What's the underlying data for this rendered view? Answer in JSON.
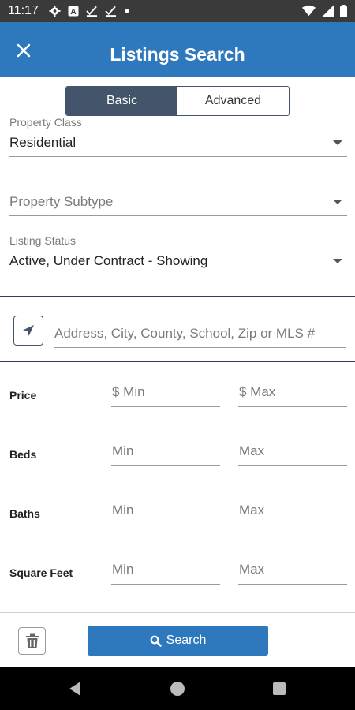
{
  "status_bar": {
    "time": "11:17",
    "icons_left": [
      "settings-icon",
      "a-icon",
      "check-icon",
      "check-icon",
      "dot-icon"
    ],
    "icons_right": [
      "wifi-icon",
      "signal-icon",
      "battery-icon"
    ]
  },
  "app_bar": {
    "title": "Listings Search",
    "close_icon": "close-icon",
    "color": "#2e78bd"
  },
  "mode_toggle": {
    "options": [
      "Basic",
      "Advanced"
    ],
    "selected": "Basic"
  },
  "property_class": {
    "label": "Property Class",
    "value": "Residential"
  },
  "property_subtype": {
    "placeholder": "Property Subtype"
  },
  "listing_status": {
    "label": "Listing Status",
    "value": "Active, Under Contract - Showing"
  },
  "location_search": {
    "icon": "location-arrow-icon",
    "placeholder": "Address, City, County, School, Zip or MLS #"
  },
  "ranges": [
    {
      "label": "Price",
      "min_placeholder": "$  Min",
      "max_placeholder": "$  Max"
    },
    {
      "label": "Beds",
      "min_placeholder": "Min",
      "max_placeholder": "Max"
    },
    {
      "label": "Baths",
      "min_placeholder": "Min",
      "max_placeholder": "Max"
    },
    {
      "label": "Square Feet",
      "min_placeholder": "Min",
      "max_placeholder": "Max"
    }
  ],
  "footer": {
    "clear_icon": "trash-icon",
    "search_icon": "search-icon",
    "search_label": "Search"
  },
  "nav_bar": {
    "buttons": [
      "back-icon",
      "home-icon",
      "recents-icon"
    ]
  }
}
